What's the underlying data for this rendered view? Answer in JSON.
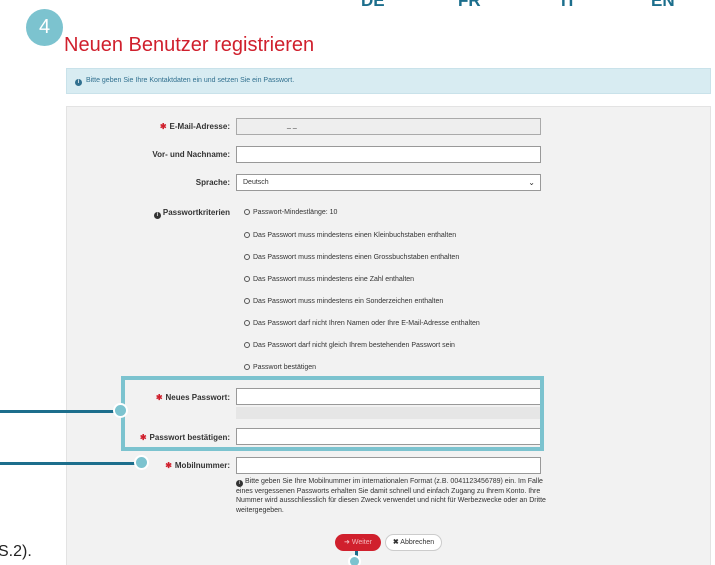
{
  "languages": [
    "DE",
    "FR",
    "IT",
    "EN"
  ],
  "step_number": "4",
  "title": "Neuen Benutzer registrieren",
  "info_text": "Bitte geben Sie Ihre Kontaktdaten ein und setzen Sie ein Passwort.",
  "form": {
    "email_label": "E-Mail-Adresse:",
    "email_value": "_ _",
    "name_label": "Vor- und Nachname:",
    "name_value": "",
    "language_label": "Sprache:",
    "language_value": "Deutsch",
    "criteria_label": "Passwortkriterien",
    "criteria": [
      "Passwort-Mindestlänge: 10",
      "Das Passwort muss mindestens einen Kleinbuchstaben enthalten",
      "Das Passwort muss mindestens einen Grossbuchstaben enthalten",
      "Das Passwort muss mindestens eine Zahl enthalten",
      "Das Passwort muss mindestens ein Sonderzeichen enthalten",
      "Das Passwort darf nicht Ihren Namen oder Ihre E-Mail-Adresse enthalten",
      "Das Passwort darf nicht gleich Ihrem bestehenden Passwort sein",
      "Passwort bestätigen"
    ],
    "new_password_label": "Neues Passwort:",
    "confirm_password_label": "Passwort bestätigen:",
    "mobile_label": "Mobilnummer:",
    "mobile_value": "",
    "mobile_help": "Bitte geben Sie Ihre Mobilnummer im internationalen Format (z.B. 0041123456789) ein. Im Falle eines vergessenen Passworts erhalten Sie damit schnell und einfach Zugang zu Ihrem Konto. Ihre Nummer wird ausschliesslich für diesen Zweck verwendet und nicht für Werbezwecke oder an Dritte weitergegeben."
  },
  "buttons": {
    "next": "Weiter",
    "cancel": "Abbrechen"
  },
  "edge_text": "S.2).",
  "colors": {
    "accent_red": "#d0202d",
    "highlight_teal": "#7cc3cf",
    "callout_navy": "#1c6e8c"
  }
}
